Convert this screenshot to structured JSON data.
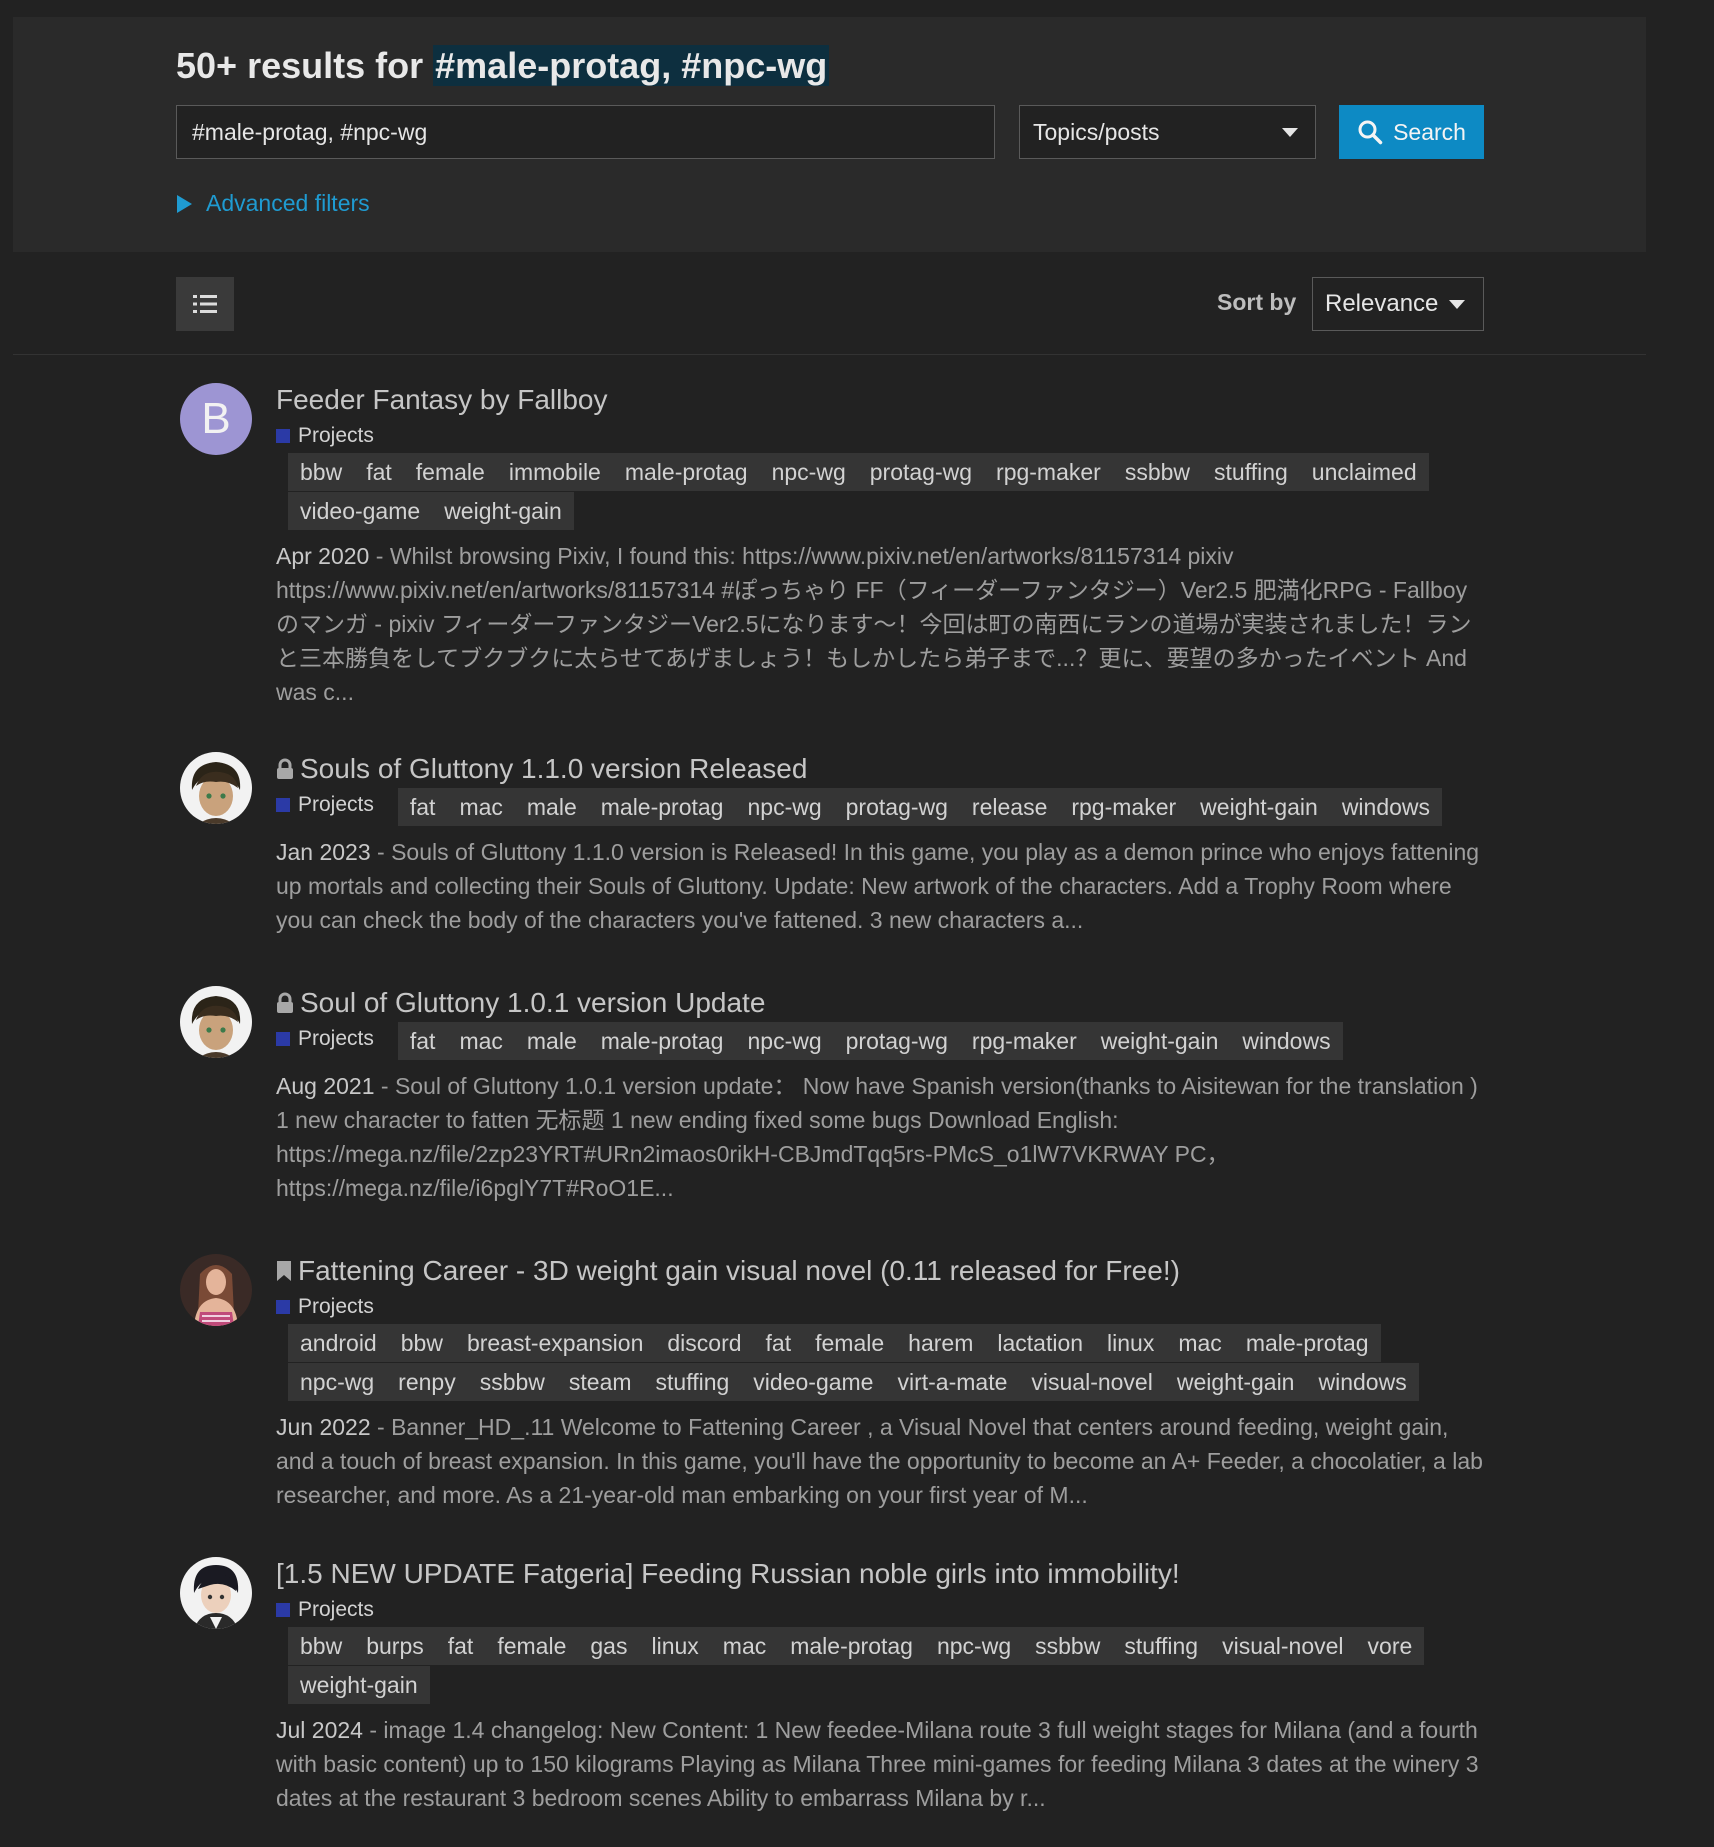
{
  "header": {
    "results_prefix": "50+ results for",
    "query_highlight": "#male-protag, #npc-wg",
    "search_value": "#male-protag, #npc-wg",
    "type_select_value": "Topics/posts",
    "search_button_label": "Search",
    "advanced_filters_label": "Advanced filters"
  },
  "controls": {
    "sort_label": "Sort by",
    "sort_value": "Relevance"
  },
  "results": [
    {
      "title": "Feeder Fantasy by Fallboy",
      "avatar_letter": "B",
      "category": "Projects",
      "tags": [
        "bbw",
        "fat",
        "female",
        "immobile",
        "male-protag",
        "npc-wg",
        "protag-wg",
        "rpg-maker",
        "ssbbw",
        "stuffing",
        "unclaimed",
        "video-game",
        "weight-gain"
      ],
      "date": "Apr 2020",
      "excerpt": "Whilst browsing Pixiv, I found this: https://www.pixiv.net/en/artworks/81157314 pixiv https://www.pixiv.net/en/artworks/81157314 #ぽっちゃり FF（フィーダーファンタジー）Ver2.5 肥満化RPG - Fallboyのマンガ - pixiv フィーダーファンタジーVer2.5になります～！今回は町の南西にランの道場が実装されました！ランと三本勝負をしてブクブクに太らせてあげましょう！もしかしたら弟子まで...？更に、要望の多かったイベント And was c..."
    },
    {
      "title": "Souls of Gluttony 1.1.0 version Released",
      "icon": "lock-icon",
      "category": "Projects",
      "tags": [
        "fat",
        "mac",
        "male",
        "male-protag",
        "npc-wg",
        "protag-wg",
        "release",
        "rpg-maker",
        "weight-gain",
        "windows"
      ],
      "date": "Jan 2023",
      "excerpt": "Souls of Gluttony 1.1.0 version is Released! In this game, you play as a demon prince who enjoys fattening up mortals and collecting their Souls of Gluttony. Update: New artwork of the characters. Add a Trophy Room where you can check the body of the characters you've fattened. 3 new characters a..."
    },
    {
      "title": "Soul of Gluttony 1.0.1 version Update",
      "icon": "lock-icon",
      "category": "Projects",
      "tags": [
        "fat",
        "mac",
        "male",
        "male-protag",
        "npc-wg",
        "protag-wg",
        "rpg-maker",
        "weight-gain",
        "windows"
      ],
      "date": "Aug 2021",
      "excerpt": "Soul of Gluttony 1.0.1 version update： Now have Spanish version(thanks to Aisitewan for the translation ) 1 new character to fatten 无标题 1 new ending fixed some bugs Download English: https://mega.nz/file/2zp23YRT#URn2imaos0rikH-CBJmdTqq5rs-PMcS_o1lW7VKRWAY PC，https://mega.nz/file/i6pglY7T#RoO1E..."
    },
    {
      "title": "Fattening Career - 3D weight gain visual novel (0.11 released for Free!)",
      "icon": "bookmark-icon",
      "category": "Projects",
      "tags": [
        "android",
        "bbw",
        "breast-expansion",
        "discord",
        "fat",
        "female",
        "harem",
        "lactation",
        "linux",
        "mac",
        "male-protag",
        "npc-wg",
        "renpy",
        "ssbbw",
        "steam",
        "stuffing",
        "video-game",
        "virt-a-mate",
        "visual-novel",
        "weight-gain",
        "windows"
      ],
      "date": "Jun 2022",
      "excerpt": "Banner_HD_.11 Welcome to Fattening Career , a Visual Novel that centers around feeding, weight gain, and a touch of breast expansion. In this game, you'll have the opportunity to become an A+ Feeder, a chocolatier, a lab researcher, and more. As a 21-year-old man embarking on your first year of M..."
    },
    {
      "title": "[1.5 NEW UPDATE Fatgeria] Feeding Russian noble girls into immobility!",
      "category": "Projects",
      "tags": [
        "bbw",
        "burps",
        "fat",
        "female",
        "gas",
        "linux",
        "mac",
        "male-protag",
        "npc-wg",
        "ssbbw",
        "stuffing",
        "visual-novel",
        "vore",
        "weight-gain"
      ],
      "date": "Jul 2024",
      "excerpt": "image 1.4 changelog: New Content: 1 New feedee-Milana route 3 full weight stages for Milana (and a fourth with basic content) up to 150 kilograms Playing as Milana Three mini-games for feeding Milana 3 dates at the winery 3 dates at the restaurant 3 bedroom scenes Ability to embarrass Milana by r..."
    }
  ],
  "colors": {
    "background": "#222222",
    "panel": "#2a2a2a",
    "accent": "#0d8ac4",
    "link": "#1f9bd1",
    "category": "#2b3aa6"
  }
}
